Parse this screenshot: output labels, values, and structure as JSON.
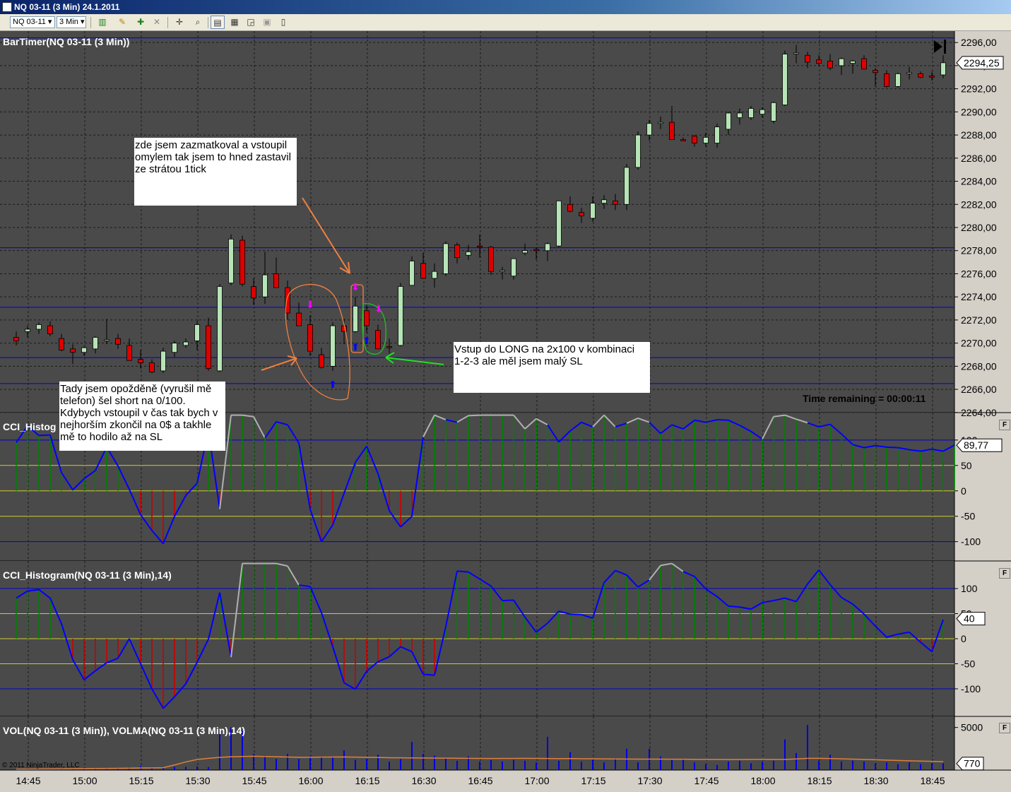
{
  "window": {
    "title": "NQ 03-11 (3 Min)  24.1.2011"
  },
  "toolbar": {
    "instrument": "NQ 03-11",
    "period": "3 Min"
  },
  "panels": {
    "price_title": "BarTimer(NQ 03-11 (3 Min))",
    "cci1_title": "CCI_Histog",
    "cci2_title": "CCI_Histogram(NQ 03-11 (3 Min),14)",
    "vol_title": "VOL(NQ 03-11 (3 Min)), VOLMA(NQ 03-11 (3 Min),14)",
    "time_remaining": "Time remaining = 00:00:11",
    "copyright": "© 2011 NinjaTrader, LLC",
    "panel_button": "F"
  },
  "annotations": {
    "note1": "zde jsem zazmatkoval a vstoupil\nomylem tak jsem to hned zastavil\nze strátou 1tick",
    "note2": "Vstup do LONG na 2x100 v kombinaci\n1-2-3 ale měl jsem malý SL",
    "note3": "Tady jsem opožděně (vyrušil mě\ntelefon) šel short na 0/100.\nKdybych vstoupil v čas tak bych v\nnejhorším zkončil na 0$ a takhle\nmě to hodilo až na SL"
  },
  "colors": {
    "background": "#4a4a4a",
    "grid": "#1a1a1a",
    "hline": "#0000cc",
    "up": "#b6e4b6",
    "down": "#dd0000",
    "cci_line": "#0000ff",
    "cci_pos": "#008000",
    "cci_neg": "#cc0000",
    "cci_extreme": "#b0b0b0",
    "band": "#cccc33",
    "volume": "#0000dd",
    "volma": "#e08040",
    "axis_bg": "#d4d0c8"
  },
  "chart_data": [
    {
      "type": "candlestick",
      "title": "BarTimer(NQ 03-11 (3 Min))",
      "x_ticks": [
        "14:45",
        "15:00",
        "15:15",
        "15:30",
        "15:45",
        "16:00",
        "16:15",
        "16:30",
        "16:45",
        "17:00",
        "17:15",
        "17:30",
        "17:45",
        "18:00",
        "18:15",
        "18:30",
        "18:45"
      ],
      "y_ticks": [
        "2264,00",
        "2266,00",
        "2268,00",
        "2270,00",
        "2272,00",
        "2274,00",
        "2276,00",
        "2278,00",
        "2280,00",
        "2282,00",
        "2284,00",
        "2286,00",
        "2288,00",
        "2290,00",
        "2292,00",
        "2294,00",
        "2296,00"
      ],
      "ylim": [
        2263.5,
        2296.5
      ],
      "last_price": "2294,25",
      "horizontal_lines": [
        2266.5,
        2268.75,
        2273.1,
        2278.25,
        2296.4
      ],
      "candles": [
        [
          2270.5,
          2271,
          2269.8,
          2270.2
        ],
        [
          2271,
          2271.5,
          2270.5,
          2271.2
        ],
        [
          2271.2,
          2271.8,
          2270.8,
          2271.6
        ],
        [
          2271.5,
          2271.9,
          2270.6,
          2270.8
        ],
        [
          2270.4,
          2270.8,
          2269.3,
          2269.4
        ],
        [
          2269.5,
          2269.9,
          2268.2,
          2269.2
        ],
        [
          2269.2,
          2269.7,
          2268.9,
          2269.6
        ],
        [
          2269.5,
          2270.6,
          2269.1,
          2270.5
        ],
        [
          2270.2,
          2272.1,
          2269.9,
          2270.3
        ],
        [
          2270.4,
          2270.8,
          2269.5,
          2269.9
        ],
        [
          2269.8,
          2270.4,
          2268.6,
          2268.5
        ],
        [
          2268.6,
          2269.4,
          2267.8,
          2268.3
        ],
        [
          2268.3,
          2268.6,
          2267.4,
          2267.5
        ],
        [
          2267.6,
          2269.6,
          2267.4,
          2269.3
        ],
        [
          2269.2,
          2270.2,
          2268.8,
          2270.0
        ],
        [
          2269.8,
          2270.4,
          2269.6,
          2270.1
        ],
        [
          2270.2,
          2271.9,
          2269.4,
          2271.6
        ],
        [
          2271.5,
          2272.2,
          2267.6,
          2267.8
        ],
        [
          2267.6,
          2275.1,
          2267.5,
          2274.9
        ],
        [
          2275.2,
          2279.4,
          2275.0,
          2279.0
        ],
        [
          2278.9,
          2279.3,
          2274.9,
          2275.1
        ],
        [
          2274.9,
          2275.6,
          2273.3,
          2273.9
        ],
        [
          2274.0,
          2277.9,
          2273.4,
          2275.9
        ],
        [
          2276.0,
          2277.4,
          2274.9,
          2274.8
        ],
        [
          2274.8,
          2275.4,
          2272.0,
          2272.6
        ],
        [
          2272.6,
          2273.5,
          2271.5,
          2271.5
        ],
        [
          2271.6,
          2272.4,
          2268.9,
          2269.3
        ],
        [
          2269.0,
          2269.6,
          2267.8,
          2267.9
        ],
        [
          2268.0,
          2271.8,
          2267.6,
          2271.5
        ],
        [
          2271.5,
          2272.1,
          2269.9,
          2271.0
        ],
        [
          2271.0,
          2274.0,
          2270.9,
          2273.2
        ],
        [
          2272.8,
          2273.3,
          2270.9,
          2271.5
        ],
        [
          2271.1,
          2271.6,
          2269.5,
          2269.5
        ],
        [
          2269.7,
          2270.4,
          2269.1,
          2269.6
        ],
        [
          2269.8,
          2275.2,
          2269.7,
          2274.9
        ],
        [
          2275.0,
          2277.5,
          2275.1,
          2277.1
        ],
        [
          2276.9,
          2277.8,
          2275.7,
          2275.6
        ],
        [
          2275.6,
          2276.9,
          2274.8,
          2276.2
        ],
        [
          2276.0,
          2278.8,
          2275.8,
          2278.6
        ],
        [
          2278.5,
          2278.7,
          2276.9,
          2277.4
        ],
        [
          2277.6,
          2278.5,
          2277.2,
          2277.9
        ],
        [
          2278.4,
          2279.4,
          2277.4,
          2278.3
        ],
        [
          2278.3,
          2278.4,
          2275.9,
          2276.2
        ],
        [
          2276.2,
          2276.6,
          2275.5,
          2276.3
        ],
        [
          2275.8,
          2277.2,
          2275.5,
          2277.3
        ],
        [
          2277.8,
          2278.6,
          2277.6,
          2278.0
        ],
        [
          2278.1,
          2278.3,
          2277.2,
          2278.0
        ],
        [
          2278.0,
          2278.7,
          2277.1,
          2278.6
        ],
        [
          2278.4,
          2282.3,
          2278.3,
          2282.3
        ],
        [
          2282.0,
          2282.7,
          2281.3,
          2281.4
        ],
        [
          2281.3,
          2281.7,
          2280.4,
          2281.0
        ],
        [
          2280.8,
          2282.7,
          2280.5,
          2282.1
        ],
        [
          2282.1,
          2282.8,
          2281.6,
          2282.4
        ],
        [
          2282.3,
          2282.9,
          2281.5,
          2282.0
        ],
        [
          2282.0,
          2285.5,
          2281.5,
          2285.2
        ],
        [
          2285.2,
          2288.3,
          2285.0,
          2288.0
        ],
        [
          2288.0,
          2289.3,
          2287.5,
          2289.0
        ],
        [
          2289.0,
          2289.6,
          2288.5,
          2289.1
        ],
        [
          2289.1,
          2290.5,
          2288.7,
          2287.6
        ],
        [
          2287.6,
          2287.8,
          2287.5,
          2287.5
        ],
        [
          2287.9,
          2288.0,
          2287.0,
          2287.3
        ],
        [
          2287.3,
          2288.2,
          2287.0,
          2287.8
        ],
        [
          2287.3,
          2289.0,
          2286.9,
          2288.7
        ],
        [
          2288.5,
          2290.0,
          2288.0,
          2289.9
        ],
        [
          2289.5,
          2290.3,
          2288.9,
          2289.9
        ],
        [
          2289.5,
          2290.5,
          2289.3,
          2290.3
        ],
        [
          2289.8,
          2290.4,
          2289.5,
          2290.2
        ],
        [
          2289.2,
          2290.9,
          2289.0,
          2290.8
        ],
        [
          2290.6,
          2295.3,
          2290.5,
          2295.0
        ],
        [
          2295.0,
          2295.8,
          2294.2,
          2295.1
        ],
        [
          2294.9,
          2295.2,
          2293.8,
          2294.3
        ],
        [
          2294.5,
          2294.9,
          2294.0,
          2294.2
        ],
        [
          2294.4,
          2295.0,
          2293.6,
          2293.8
        ],
        [
          2294.0,
          2294.7,
          2293.2,
          2294.6
        ],
        [
          2294.2,
          2294.5,
          2293.3,
          2294.4
        ],
        [
          2294.6,
          2294.9,
          2293.9,
          2293.7
        ],
        [
          2293.6,
          2293.8,
          2292.2,
          2293.4
        ],
        [
          2293.3,
          2293.6,
          2292.1,
          2292.2
        ],
        [
          2292.2,
          2293.4,
          2292.1,
          2293.3
        ],
        [
          2293.3,
          2293.9,
          2292.8,
          2293.4
        ],
        [
          2293.3,
          2293.5,
          2292.9,
          2293.0
        ],
        [
          2293.1,
          2293.5,
          2292.7,
          2293.0
        ],
        [
          2293.2,
          2294.9,
          2292.9,
          2294.25
        ]
      ]
    },
    {
      "type": "histogram+line",
      "title": "CCI_Histog",
      "y_ticks": [
        "-100",
        "-50",
        "0",
        "50",
        "100"
      ],
      "ylim": [
        -138,
        154
      ],
      "last_value": "89,77",
      "cci": [
        95,
        128,
        109,
        110,
        36,
        2,
        24,
        40,
        86,
        49,
        3,
        -47,
        -78,
        -104,
        -50,
        -9,
        15,
        119,
        -36,
        181,
        172,
        146,
        104,
        136,
        130,
        94,
        -36,
        -100,
        -67,
        -5,
        56,
        88,
        34,
        -39,
        -71,
        -50,
        106,
        164,
        140,
        135,
        148,
        161,
        177,
        175,
        158,
        122,
        142,
        130,
        96,
        118,
        135,
        126,
        162,
        126,
        133,
        143,
        135,
        113,
        130,
        122,
        139,
        135,
        140,
        139,
        129,
        117,
        102,
        146,
        150,
        141,
        134,
        126,
        131,
        112,
        91,
        85,
        89,
        86,
        85,
        81,
        78,
        82,
        78,
        90
      ]
    },
    {
      "type": "histogram+line",
      "title": "CCI_Histogram(NQ 03-11 (3 Min),14)",
      "y_ticks": [
        "-100",
        "-50",
        "0",
        "50",
        "100"
      ],
      "ylim": [
        -155,
        155
      ],
      "last_value": "40",
      "cci": [
        81,
        95,
        98,
        81,
        30,
        -42,
        -82,
        -64,
        -48,
        -39,
        0,
        -50,
        -100,
        -139,
        -116,
        -90,
        -47,
        -1,
        92,
        -37,
        189,
        207,
        194,
        166,
        145,
        107,
        104,
        52,
        -16,
        -88,
        -101,
        -65,
        -46,
        -36,
        -16,
        -26,
        -71,
        -73,
        24,
        135,
        133,
        119,
        105,
        76,
        77,
        43,
        13,
        31,
        55,
        49,
        48,
        41,
        112,
        136,
        127,
        103,
        117,
        146,
        155,
        134,
        124,
        99,
        84,
        65,
        63,
        59,
        72,
        76,
        81,
        74,
        109,
        137,
        108,
        82,
        69,
        49,
        25,
        3,
        9,
        13,
        -7,
        -26,
        38
      ]
    },
    {
      "type": "bar+line",
      "title": "VOL(NQ 03-11 (3 Min)), VOLMA(NQ 03-11 (3 Min),14)",
      "y_ticks": [
        "5000"
      ],
      "last_value": "770",
      "ylim": [
        0,
        6300
      ],
      "volume": [
        80,
        130,
        160,
        180,
        240,
        200,
        280,
        210,
        260,
        210,
        330,
        460,
        290,
        290,
        370,
        380,
        430,
        350,
        4700,
        5000,
        4600,
        1900,
        1700,
        1300,
        1900,
        1300,
        1600,
        1600,
        1600,
        2300,
        1200,
        1300,
        1800,
        1000,
        1300,
        3300,
        1900,
        1700,
        1400,
        1100,
        1600,
        1000,
        1200,
        1000,
        1200,
        1100,
        900,
        3900,
        1100,
        2100,
        1000,
        1200,
        900,
        1400,
        2500,
        900,
        2500,
        1600,
        1200,
        1300,
        900,
        700,
        600,
        1000,
        1100,
        800,
        1000,
        1100,
        3600,
        2000,
        5300,
        1100,
        1800,
        1000,
        1100,
        1000,
        800,
        900,
        700,
        900,
        700,
        800,
        800
      ],
      "volma": [
        100,
        110,
        120,
        130,
        150,
        160,
        180,
        190,
        200,
        210,
        230,
        250,
        260,
        280,
        600,
        960,
        1240,
        1380,
        1490,
        1560,
        1600,
        1630,
        1600,
        1560,
        1530,
        1500,
        1500,
        1520,
        1530,
        1540,
        1520,
        1500,
        1480,
        1450,
        1440,
        1430,
        1420,
        1410,
        1400,
        1390,
        1380,
        1370,
        1360,
        1370,
        1370,
        1380,
        1370,
        1360,
        1350,
        1360,
        1340,
        1330,
        1320,
        1310,
        1300,
        1290,
        1280,
        1280,
        1270,
        1270,
        1260,
        1250,
        1250,
        1240,
        1240,
        1250,
        1260,
        1250,
        1250,
        1310,
        1380,
        1380,
        1360,
        1330,
        1290,
        1250,
        1210,
        1170,
        1130,
        1090,
        1060,
        1030,
        990
      ]
    }
  ]
}
